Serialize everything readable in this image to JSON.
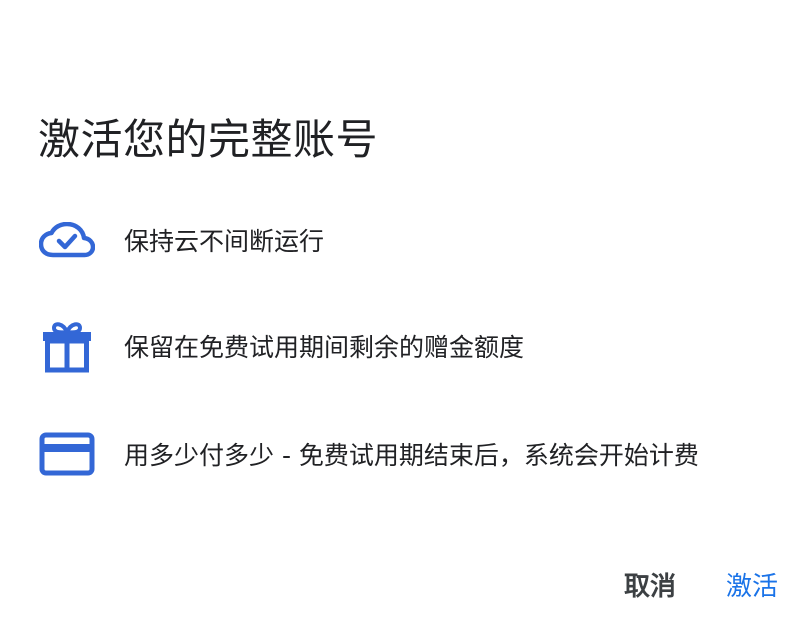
{
  "dialog": {
    "title": "激活您的完整账号",
    "features": [
      {
        "icon": "cloud-check-icon",
        "text": "保持云不间断运行"
      },
      {
        "icon": "gift-icon",
        "text": "保留在免费试用期间剩余的赠金额度"
      },
      {
        "icon": "credit-card-icon",
        "text": "用多少付多少 - 免费试用期结束后，系统会开始计费"
      }
    ],
    "actions": {
      "cancel_label": "取消",
      "activate_label": "激活"
    }
  },
  "colors": {
    "accent": "#1a73e8",
    "icon": "#3367d6",
    "text": "#202124"
  }
}
